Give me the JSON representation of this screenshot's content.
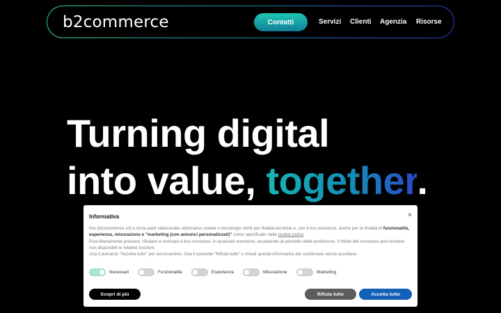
{
  "header": {
    "logo_prefix": "b",
    "logo_digit": "2",
    "logo_suffix": "commerce",
    "cta_label": "Contatti",
    "nav": [
      "Servizi",
      "Clienti",
      "Agenzia",
      "Risorse"
    ]
  },
  "hero": {
    "line1": "Turning digital",
    "line2_start": "into value, ",
    "line2_accent": "together",
    "line2_end": "."
  },
  "cookie_modal": {
    "title": "Informativa",
    "close_glyph": "×",
    "para1_start": "Noi (b2commerce srl) e terze parti selezionate utilizziamo cookie o tecnologie simili per finalità tecniche e, con il tuo consenso, anche per le finalità di ",
    "para1_bold": "funzionalità, esperienza, misurazione e \"marketing (con annunci personalizzati)\"",
    "para1_mid": " come specificato nella ",
    "para1_link": "cookie policy",
    "para1_end": ".",
    "para2": "Puoi liberamente prestare, rifiutare o revocare il tuo consenso, in qualsiasi momento, accedendo al pannello delle preferenze. Il rifiuto del consenso può rendere non disponibili le relative funzioni.",
    "para3": "Usa il pulsante \"Accetta tutto\" per acconsentire. Usa il pulsante \"Rifiuta tutto\" o chiudi questa informativa per continuare senza accettare.",
    "toggles": [
      {
        "label": "Necessari",
        "on": true
      },
      {
        "label": "Funzionalità",
        "on": false
      },
      {
        "label": "Esperienza",
        "on": false
      },
      {
        "label": "Misurazione",
        "on": false
      },
      {
        "label": "Marketing",
        "on": false
      }
    ],
    "learn_more_label": "Scopri di più",
    "reject_label": "Rifiuta tutto",
    "accept_label": "Accetta tutto"
  },
  "colors": {
    "accept": "#1360b8",
    "reject": "#5c5c5c",
    "cta_top": "#1fc7b4",
    "cta_bottom": "#117f98"
  }
}
